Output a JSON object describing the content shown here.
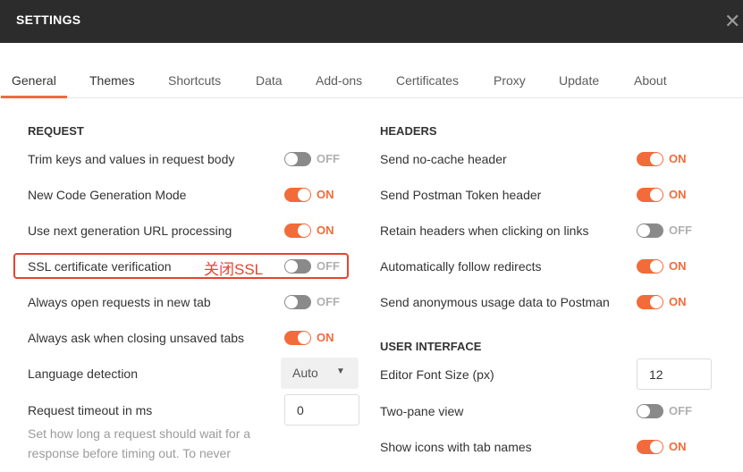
{
  "window": {
    "title": "SETTINGS",
    "close_glyph": "✕"
  },
  "tabs": [
    {
      "label": "General",
      "active": true
    },
    {
      "label": "Themes"
    },
    {
      "label": "Shortcuts"
    },
    {
      "label": "Data"
    },
    {
      "label": "Add-ons"
    },
    {
      "label": "Certificates"
    },
    {
      "label": "Proxy"
    },
    {
      "label": "Update"
    },
    {
      "label": "About"
    }
  ],
  "request": {
    "title": "REQUEST",
    "trim_keys": {
      "label": "Trim keys and values in request body",
      "state": "OFF"
    },
    "code_gen": {
      "label": "New Code Generation Mode",
      "state": "ON"
    },
    "url_processing": {
      "label": "Use next generation URL processing",
      "state": "ON"
    },
    "ssl": {
      "label": "SSL certificate verification",
      "state": "OFF",
      "annotation": "关闭SSL"
    },
    "new_tab": {
      "label": "Always open requests in new tab",
      "state": "OFF"
    },
    "ask_closing": {
      "label": "Always ask when closing unsaved tabs",
      "state": "ON"
    },
    "language": {
      "label": "Language detection",
      "value": "Auto"
    },
    "timeout": {
      "label": "Request timeout in ms",
      "value": "0",
      "help_line1": "Set how long a request should wait for a",
      "help_line2": "response before timing out. To never"
    }
  },
  "headers": {
    "title": "HEADERS",
    "no_cache": {
      "label": "Send no-cache header",
      "state": "ON"
    },
    "postman_token": {
      "label": "Send Postman Token header",
      "state": "ON"
    },
    "retain_headers": {
      "label": "Retain headers when clicking on links",
      "state": "OFF"
    },
    "follow_redirects": {
      "label": "Automatically follow redirects",
      "state": "ON"
    },
    "usage_data": {
      "label": "Send anonymous usage data to Postman",
      "state": "ON"
    }
  },
  "ui": {
    "title": "USER INTERFACE",
    "font_size": {
      "label": "Editor Font Size (px)",
      "value": "12"
    },
    "two_pane": {
      "label": "Two-pane view",
      "state": "OFF"
    },
    "tab_icons": {
      "label": "Show icons with tab names",
      "state": "ON"
    }
  },
  "colors": {
    "accent": "#f26b3a",
    "toggle_off": "#8a8a8a",
    "titlebar": "#2c2c2c",
    "annotation": "#e8432f"
  }
}
